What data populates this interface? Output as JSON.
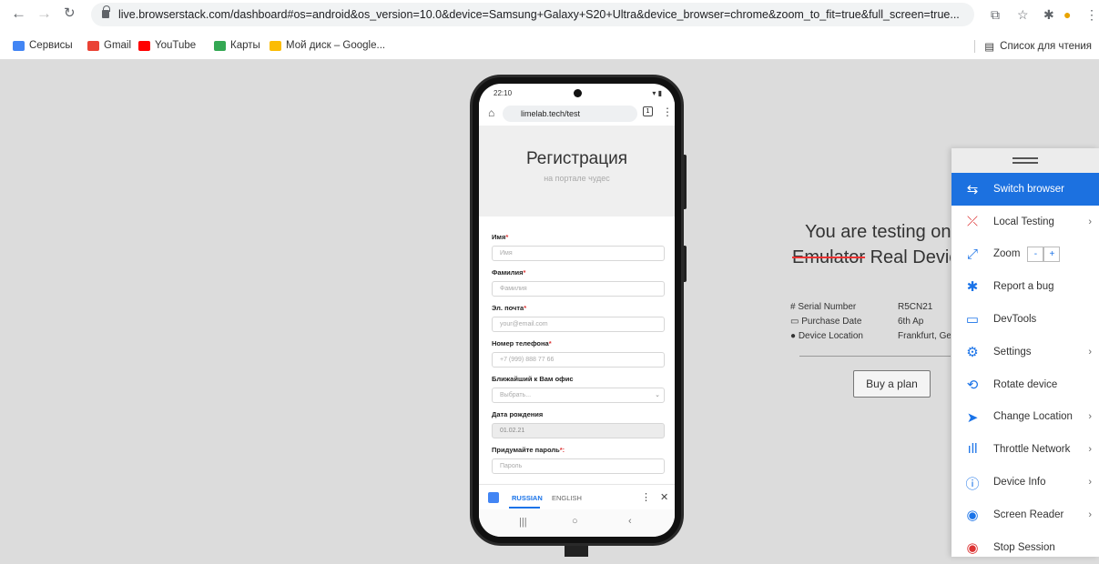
{
  "browser": {
    "url": "live.browserstack.com/dashboard#os=android&os_version=10.0&device=Samsung+Galaxy+S20+Ultra&device_browser=chrome&zoom_to_fit=true&full_screen=true...",
    "bookmarks": [
      {
        "label": "Сервисы",
        "color": "#4285f4"
      },
      {
        "label": "Gmail",
        "color": "#ea4335"
      },
      {
        "label": "YouTube",
        "color": "#ff0000"
      },
      {
        "label": "Карты",
        "color": "#34a853"
      },
      {
        "label": "Мой диск – Google...",
        "color": "#fbbc04"
      }
    ],
    "reading_list": "Список для чтения"
  },
  "phone": {
    "status_time": "22:10",
    "url": "limelab.tech/test",
    "tab_count": "1",
    "title": "Регистрация",
    "subtitle": "на портале чудес",
    "fields": [
      {
        "label": "Имя",
        "required": "*",
        "placeholder": "Имя"
      },
      {
        "label": "Фамилия",
        "required": "*",
        "placeholder": "Фамилия"
      },
      {
        "label": "Эл. почта",
        "required": "*",
        "placeholder": "your@email.com"
      },
      {
        "label": "Номер телефона",
        "required": "*",
        "placeholder": "+7 (999) 888 77 66"
      },
      {
        "label": "Ближайший к Вам офис",
        "required": "",
        "placeholder": "Выбрать..."
      },
      {
        "label": "Дата рождения",
        "required": "",
        "placeholder": "01.02.21"
      },
      {
        "label": "Придумайте пароль",
        "required": "*:",
        "placeholder": "Пароль"
      }
    ],
    "translate": {
      "lang_active": "RUSSIAN",
      "lang_other": "ENGLISH"
    }
  },
  "info": {
    "title": "You are testing on",
    "strike": "Emulator",
    "sub": " Real Device",
    "rows": [
      {
        "label": "Serial Number",
        "value": "R5CN21",
        "icon": "#"
      },
      {
        "label": "Purchase Date",
        "value": "6th Ap",
        "icon": "▭"
      },
      {
        "label": "Device Location",
        "value": "Frankfurt, Ge",
        "icon": "●"
      }
    ],
    "buy": "Buy a plan"
  },
  "panel": {
    "items": [
      {
        "label": "Switch browser",
        "icon": "⇆",
        "active": true
      },
      {
        "label": "Local Testing",
        "icon": "⤫",
        "arrow": true
      },
      {
        "label": "Zoom",
        "icon": "⤢"
      },
      {
        "label": "Report a bug",
        "icon": "✱"
      },
      {
        "label": "DevTools",
        "icon": "▭"
      },
      {
        "label": "Settings",
        "icon": "⚙",
        "arrow": true
      },
      {
        "label": "Rotate device",
        "icon": "⟲"
      },
      {
        "label": "Change Location",
        "icon": "➤",
        "arrow": true
      },
      {
        "label": "Throttle Network",
        "icon": "ıll",
        "arrow": true
      },
      {
        "label": "Device Info",
        "icon": "ⓘ",
        "arrow": true
      },
      {
        "label": "Screen Reader",
        "icon": "◉",
        "arrow": true
      },
      {
        "label": "Stop Session",
        "icon": "◉"
      }
    ],
    "zoom_minus": "-",
    "zoom_plus": "+"
  }
}
